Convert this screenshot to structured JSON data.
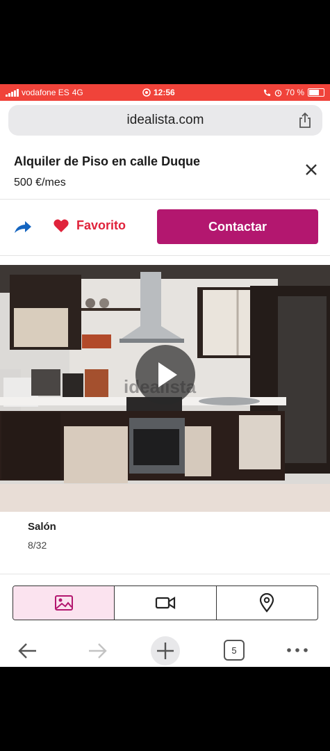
{
  "status_bar": {
    "carrier": "vodafone ES",
    "network": "4G",
    "time": "12:56",
    "battery": "70 %"
  },
  "browser": {
    "url": "idealista.com",
    "tabs_count": "5"
  },
  "listing": {
    "title": "Alquiler de Piso en calle Duque",
    "price": "500 €/mes"
  },
  "actions": {
    "favorite_label": "Favorito",
    "contact_label": "Contactar"
  },
  "gallery": {
    "watermark": "idealista",
    "caption": "Salón",
    "counter": "8/32"
  },
  "colors": {
    "status_bar": "#f0433a",
    "brand": "#b3176f",
    "favorite": "#e0233b",
    "share": "#1565c0"
  }
}
